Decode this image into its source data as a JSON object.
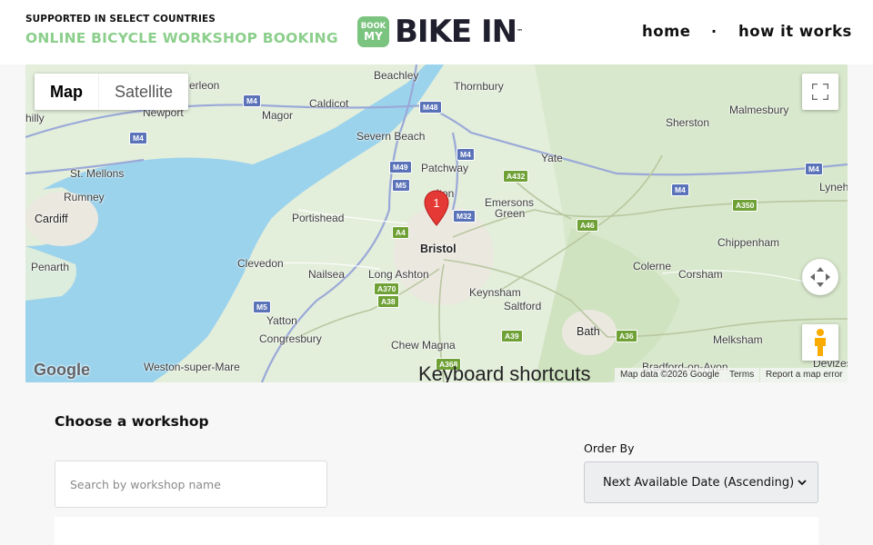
{
  "header": {
    "supported": "SUPPORTED IN SELECT COUNTRIES",
    "tagline": "ONLINE BICYCLE WORKSHOP BOOKING",
    "logo": {
      "badge_top": "BOOK",
      "badge_bottom": "MY",
      "text": "BIKE IN",
      "tm": "™"
    },
    "nav": {
      "home": "home",
      "separator": "·",
      "how_it_works": "how it works"
    }
  },
  "map": {
    "type_buttons": {
      "map": "Map",
      "satellite": "Satellite"
    },
    "places": [
      "Beachley",
      "Thornbury",
      "Malmesbury",
      "Newport",
      "Magor",
      "Caldicot",
      "Sherston",
      "Severn Beach",
      "Patchway",
      "Yate",
      "St. Mellons",
      "Rumney",
      "Lyneh",
      "Cardiff",
      "Portishead",
      "Emersons",
      "Green",
      "Bristol",
      "Chippenham",
      "Penarth",
      "Clevedon",
      "Nailsea",
      "Long Ashton",
      "Colerne",
      "Corsham",
      "Keynsham",
      "Saltford",
      "Yatton",
      "Congresbury",
      "Chew Magna",
      "Bath",
      "Melksham",
      "Weston-super-Mare",
      "Bradford-on-Avon",
      "Devizes",
      "hilly",
      "erleon",
      "lton"
    ],
    "roads": [
      "M4",
      "M48",
      "M4",
      "M49",
      "M5",
      "A432",
      "M4",
      "M32",
      "A4",
      "A46",
      "A350",
      "M4",
      "A370",
      "A38",
      "M5",
      "A39",
      "A36",
      "A368",
      "M4"
    ],
    "marker_label": "1",
    "google": "Google",
    "keyboard_shortcuts": "Keyboard shortcuts",
    "attribution": {
      "data": "Map data ©2026 Google",
      "terms": "Terms",
      "report": "Report a map error"
    }
  },
  "main": {
    "title": "Choose a workshop",
    "search_placeholder": "Search by workshop name",
    "order_by_label": "Order By",
    "order_by_value": "Next Available Date (Ascending)"
  },
  "colors": {
    "brand_green": "#8ccf8c",
    "logo_dark": "#1f1f2e",
    "water": "#9cd3ec",
    "land": "#e3eedb"
  }
}
